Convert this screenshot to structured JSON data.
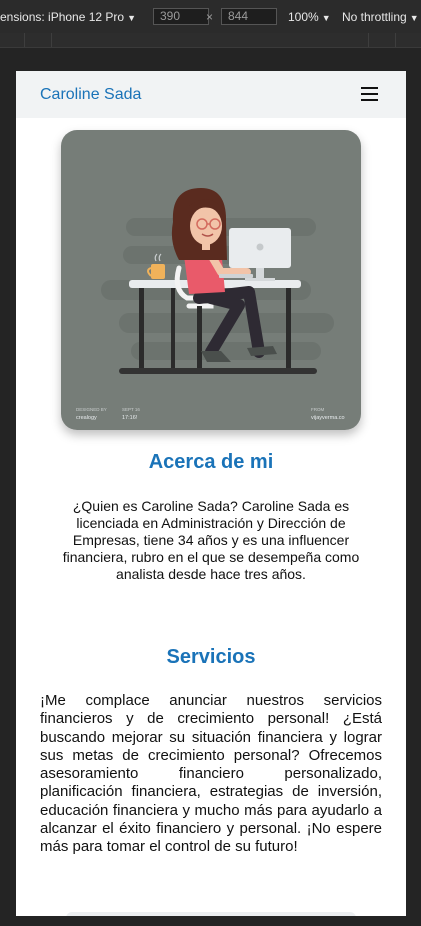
{
  "devtools": {
    "dimensions_label": "ensions: iPhone 12 Pro",
    "width_value": "390",
    "times": "×",
    "height_value": "844",
    "zoom": "100%",
    "throttling": "No throttling"
  },
  "navbar": {
    "brand": "Caroline Sada",
    "menu_icon": "hamburger-icon"
  },
  "hero": {
    "credits": {
      "designed_by_label": "DESIGNED BY",
      "designed_by": "crealogy",
      "date_label": "SEPT 16",
      "date_value": "17:16!",
      "from_label": "FROM",
      "from_value": "vijayverma.co"
    }
  },
  "about": {
    "title": "Acerca de mi",
    "text": "¿Quien es Caroline Sada? Caroline Sada es licenciada en Administración y Dirección de Empresas, tiene 34 años y es una influencer financiera, rubro en el que se desempeña como analista desde hace tres años."
  },
  "services": {
    "title": "Servicios",
    "text": "¡Me complace anunciar nuestros servicios financieros y de crecimiento personal! ¿Está buscando mejorar su situación financiera y lograr sus metas de crecimiento personal? Ofrecemos asesoramiento financiero personalizado, planificación financiera, estrategias de inversión, educación financiera y mucho más para ayudarlo a alcanzar el éxito financiero y personal. ¡No espere más para tomar el control de su futuro!"
  },
  "colors": {
    "accent": "#1a73b8",
    "hero_bg": "#767d78",
    "navbar_bg": "#f1f3f4"
  }
}
